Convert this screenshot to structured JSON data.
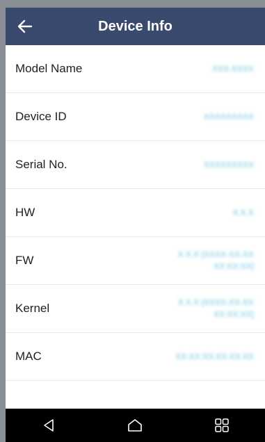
{
  "header": {
    "title": "Device Info",
    "back_icon": "arrow-left-icon"
  },
  "info_rows": [
    {
      "label": "Model Name",
      "value": "XXX-XXXX"
    },
    {
      "label": "Device ID",
      "value": "XXXXXXXXX"
    },
    {
      "label": "Serial No.",
      "value": "XXXXXXXXX"
    },
    {
      "label": "HW",
      "value": "X.X.X"
    },
    {
      "label": "FW",
      "value": "X.X.X [XXXX-XX-XX XX:XX:XX]"
    },
    {
      "label": "Kernel",
      "value": "X.X.X [XXXX-XX-XX XX:XX:XX]"
    },
    {
      "label": "MAC",
      "value": "XX:XX:XX:XX:XX:XX"
    }
  ],
  "navbar": {
    "back_icon": "nav-back-triangle-icon",
    "home_icon": "nav-home-icon",
    "recents_icon": "nav-recents-grid-icon"
  },
  "colors": {
    "header_bg": "#3a4a6e",
    "value_text": "#6ec5de",
    "navbar_bg": "#000000"
  }
}
